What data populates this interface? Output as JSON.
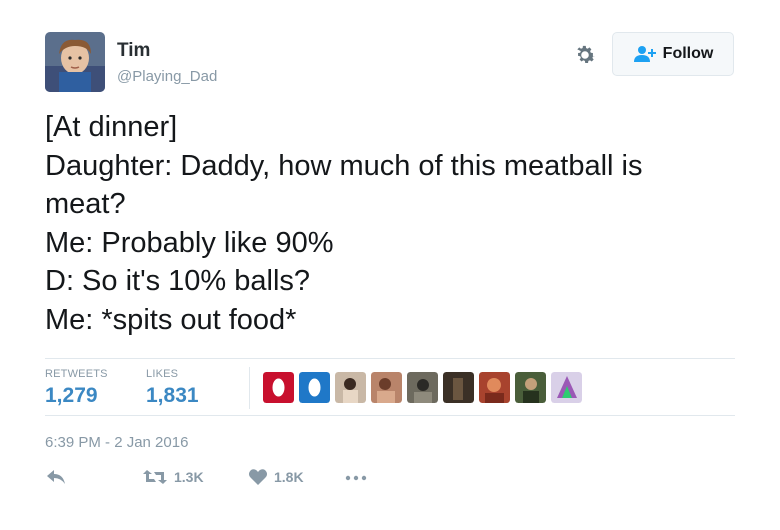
{
  "user": {
    "name": "Tim",
    "handle": "@Playing_Dad"
  },
  "follow_button": {
    "label": "Follow"
  },
  "tweet_lines": [
    "[At dinner]",
    "Daughter: Daddy, how much of this meatball is",
    "meat?",
    "Me: Probably like 90%",
    "D: So it's 10% balls?",
    "Me: *spits out food*"
  ],
  "stats": {
    "retweets_label": "RETWEETS",
    "retweets_value": "1,279",
    "likes_label": "LIKES",
    "likes_value": "1,831"
  },
  "timestamp": "6:39 PM - 2 Jan 2016",
  "actions": {
    "retweet_count": "1.3K",
    "like_count": "1.8K"
  },
  "colors": {
    "accent_blue": "#3b88c3",
    "muted": "#8899a6",
    "border": "#e1e8ed"
  },
  "icons": [
    "settings-gear-icon",
    "follow-add-user-icon",
    "reply-icon",
    "retweet-icon",
    "heart-icon",
    "more-dots-icon"
  ]
}
